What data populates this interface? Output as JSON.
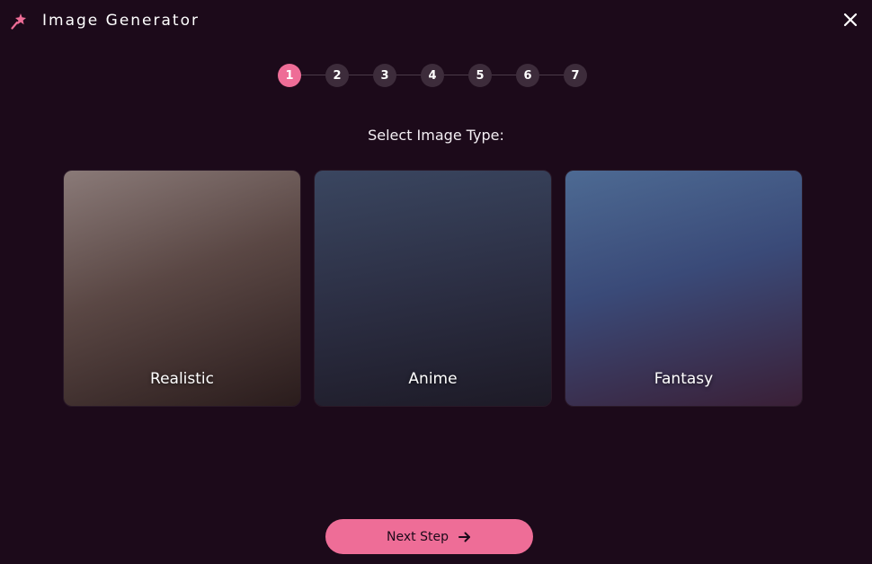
{
  "window": {
    "title": "Image Generator",
    "logo_icon": "sparkle-wand-icon",
    "close_icon": "close-icon"
  },
  "stepper": {
    "current_step": 1,
    "steps": [
      "1",
      "2",
      "3",
      "4",
      "5",
      "6",
      "7"
    ]
  },
  "section": {
    "title": "Select Image Type:"
  },
  "image_types": [
    {
      "label": "Realistic"
    },
    {
      "label": "Anime"
    },
    {
      "label": "Fantasy"
    }
  ],
  "footer": {
    "next_label": "Next Step",
    "next_icon": "arrow-right-icon"
  },
  "colors": {
    "background": "#1c0a1a",
    "accent": "#ee6d97",
    "step_inactive": "#3d2c3b"
  }
}
